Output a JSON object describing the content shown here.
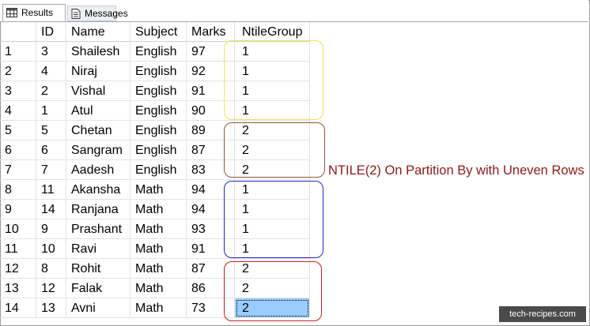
{
  "tabs": [
    {
      "label": "Results",
      "icon": "grid-icon"
    },
    {
      "label": "Messages",
      "icon": "document-icon"
    }
  ],
  "table": {
    "columns": [
      "",
      "ID",
      "Name",
      "Subject",
      "Marks",
      "NtileGroup"
    ],
    "rows": [
      [
        "1",
        "3",
        "Shailesh",
        "English",
        "97",
        "1"
      ],
      [
        "2",
        "4",
        "Niraj",
        "English",
        "92",
        "1"
      ],
      [
        "3",
        "2",
        "Vishal",
        "English",
        "91",
        "1"
      ],
      [
        "4",
        "1",
        "Atul",
        "English",
        "90",
        "1"
      ],
      [
        "5",
        "5",
        "Chetan",
        "English",
        "89",
        "2"
      ],
      [
        "6",
        "6",
        "Sangram",
        "English",
        "87",
        "2"
      ],
      [
        "7",
        "7",
        "Aadesh",
        "English",
        "83",
        "2"
      ],
      [
        "8",
        "11",
        "Akansha",
        "Math",
        "94",
        "1"
      ],
      [
        "9",
        "14",
        "Ranjana",
        "Math",
        "94",
        "1"
      ],
      [
        "10",
        "9",
        "Prashant",
        "Math",
        "93",
        "1"
      ],
      [
        "11",
        "10",
        "Ravi",
        "Math",
        "91",
        "1"
      ],
      [
        "12",
        "8",
        "Rohit",
        "Math",
        "87",
        "2"
      ],
      [
        "13",
        "12",
        "Falak",
        "Math",
        "86",
        "2"
      ],
      [
        "14",
        "13",
        "Avni",
        "Math",
        "73",
        "2"
      ]
    ]
  },
  "annotation": "NTILE(2) On Partition By with Uneven Rows",
  "watermark": "tech-recipes.com",
  "colors": {
    "group_english_1": "#e6e65a",
    "group_english_2": "#8b5a3c",
    "group_math_1": "#2323c8",
    "group_math_2": "#c81e1e",
    "annotation": "#8b1a1a",
    "selection": "#99ccff"
  }
}
